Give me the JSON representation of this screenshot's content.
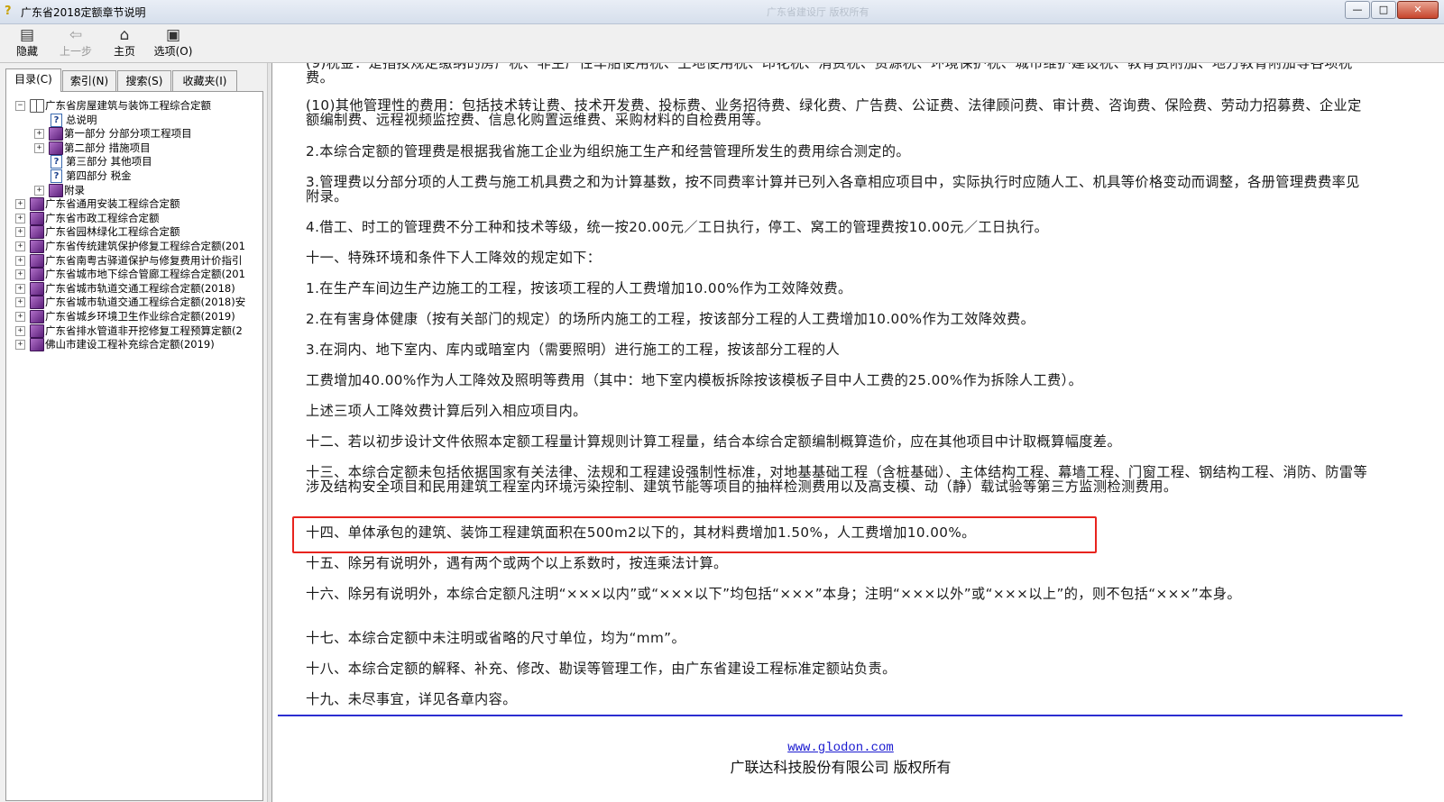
{
  "window": {
    "title": "广东省2018定额章节说明",
    "faded_text": "广东省建设厅 版权所有",
    "controls": [
      "—",
      "□",
      "✕"
    ]
  },
  "toolbar": {
    "buttons": [
      {
        "label": "隐藏",
        "icon": "hide-icon",
        "glyph": "▤",
        "enabled": true
      },
      {
        "label": "上一步",
        "icon": "back-arrow-icon",
        "glyph": "⇦",
        "enabled": false
      },
      {
        "label": "主页",
        "icon": "home-icon",
        "glyph": "⌂",
        "enabled": true
      },
      {
        "label": "选项(O)",
        "icon": "options-icon",
        "glyph": "▣",
        "enabled": true
      }
    ]
  },
  "sidebar": {
    "tabs": [
      "目录(C)",
      "索引(N)",
      "搜索(S)",
      "收藏夹(I)"
    ],
    "active_tab": "目录(C)",
    "tree": [
      {
        "label": "广东省房屋建筑与装饰工程综合定额",
        "level": 0,
        "expander": "−",
        "icon": "open-book-icon"
      },
      {
        "label": "总说明",
        "level": 2,
        "expander": "",
        "icon": "help-page-icon"
      },
      {
        "label": "第一部分 分部分项工程项目",
        "level": 1,
        "expander": "+",
        "icon": "book-icon"
      },
      {
        "label": "第二部分 措施项目",
        "level": 1,
        "expander": "+",
        "icon": "book-icon"
      },
      {
        "label": "第三部分 其他项目",
        "level": 2,
        "expander": "",
        "icon": "help-page-icon"
      },
      {
        "label": "第四部分 税金",
        "level": 2,
        "expander": "",
        "icon": "help-page-icon"
      },
      {
        "label": "附录",
        "level": 1,
        "expander": "+",
        "icon": "book-icon"
      },
      {
        "label": "广东省通用安装工程综合定额",
        "level": 0,
        "expander": "+",
        "icon": "book-icon"
      },
      {
        "label": "广东省市政工程综合定额",
        "level": 0,
        "expander": "+",
        "icon": "book-icon"
      },
      {
        "label": "广东省园林绿化工程综合定额",
        "level": 0,
        "expander": "+",
        "icon": "book-icon"
      },
      {
        "label": "广东省传统建筑保护修复工程综合定额(201",
        "level": 0,
        "expander": "+",
        "icon": "book-icon"
      },
      {
        "label": "广东省南粤古驿道保护与修复费用计价指引",
        "level": 0,
        "expander": "+",
        "icon": "book-icon"
      },
      {
        "label": "广东省城市地下综合管廊工程综合定额(201",
        "level": 0,
        "expander": "+",
        "icon": "book-icon"
      },
      {
        "label": "广东省城市轨道交通工程综合定额(2018)",
        "level": 0,
        "expander": "+",
        "icon": "book-icon"
      },
      {
        "label": "广东省城市轨道交通工程综合定额(2018)安",
        "level": 0,
        "expander": "+",
        "icon": "book-icon"
      },
      {
        "label": "广东省城乡环境卫生作业综合定额(2019)",
        "level": 0,
        "expander": "+",
        "icon": "book-icon"
      },
      {
        "label": "广东省排水管道非开挖修复工程预算定额(2",
        "level": 0,
        "expander": "+",
        "icon": "book-icon"
      },
      {
        "label": "佛山市建设工程补充综合定额(2019)",
        "level": 0,
        "expander": "+",
        "icon": "book-icon"
      }
    ]
  },
  "content": {
    "paragraphs": [
      "(9)税金：是指按规定缴纳的房产税、非生产性车船使用税、土地使用税、印花税、消费税、资源税、环境保护税、城市维护建设税、教育费附加、地方教育附加等各项税费。",
      "(10)其他管理性的费用：包括技术转让费、技术开发费、投标费、业务招待费、绿化费、广告费、公证费、法律顾问费、审计费、咨询费、保险费、劳动力招募费、企业定额编制费、远程视频监控费、信息化购置运维费、采购材料的自检费用等。",
      "2.本综合定额的管理费是根据我省施工企业为组织施工生产和经营管理所发生的费用综合测定的。",
      "3.管理费以分部分项的人工费与施工机具费之和为计算基数，按不同费率计算并已列入各章相应项目中，实际执行时应随人工、机具等价格变动而调整，各册管理费费率见附录。",
      "4.借工、时工的管理费不分工种和技术等级，统一按20.00元／工日执行，停工、窝工的管理费按10.00元／工日执行。",
      "十一、特殊环境和条件下人工降效的规定如下：",
      "1.在生产车间边生产边施工的工程，按该项工程的人工费增加10.00%作为工效降效费。",
      "2.在有害身体健康（按有关部门的规定）的场所内施工的工程，按该部分工程的人工费增加10.00%作为工效降效费。",
      "3.在洞内、地下室内、库内或暗室内（需要照明）进行施工的工程，按该部分工程的人",
      "工费增加40.00%作为人工降效及照明等费用（其中：地下室内模板拆除按该模板子目中人工费的25.00%作为拆除人工费）。",
      "上述三项人工降效费计算后列入相应项目内。",
      "十二、若以初步设计文件依照本定额工程量计算规则计算工程量，结合本综合定额编制概算造价，应在其他项目中计取概算幅度差。",
      "十三、本综合定额未包括依据国家有关法律、法规和工程建设强制性标准，对地基基础工程（含桩基础）、主体结构工程、幕墙工程、门窗工程、钢结构工程、消防、防雷等涉及结构安全项目和民用建筑工程室内环境污染控制、建筑节能等项目的抽样检测费用以及高支模、动（静）载试验等第三方监测检测费用。",
      "十四、单体承包的建筑、装饰工程建筑面积在500m2以下的，其材料费增加1.50%，人工费增加10.00%。",
      "十五、除另有说明外，遇有两个或两个以上系数时，按连乘法计算。",
      "十六、除另有说明外，本综合定额凡注明“×××以内”或“×××以下”均包括“×××”本身；注明“×××以外”或“×××以上”的，则不包括“×××”本身。",
      "十七、本综合定额中未注明或省略的尺寸单位，均为“mm”。",
      "十八、本综合定额的解释、补充、修改、勘误等管理工作，由广东省建设工程标准定额站负责。",
      "十九、未尽事宜，详见各章内容。"
    ],
    "highlighted_index": 13,
    "footer": {
      "link": "www.glodon.com",
      "copyright": "广联达科技股份有限公司 版权所有"
    },
    "highlight_color": "#e8241e"
  }
}
